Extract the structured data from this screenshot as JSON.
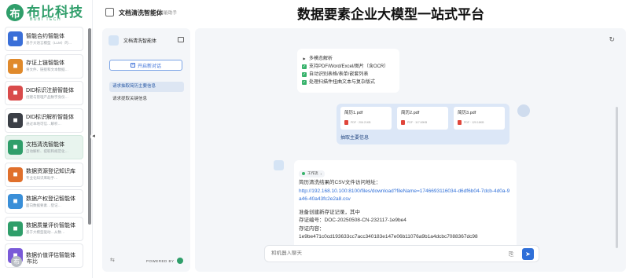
{
  "brand": {
    "logo_mark": "布",
    "name": "布比科技",
    "sub": "BUBI TECH",
    "platform_title": "数据要素企业大模型一站式平台"
  },
  "agents": [
    {
      "name": "智能合约智能体",
      "desc": "基于大语言模型（LLM）的…",
      "icon": "contract-icon",
      "color": "#3a6fd8"
    },
    {
      "name": "存证上链智能体",
      "desc": "将文件、链接和文本数据…",
      "icon": "chain-icon",
      "color": "#e08a2c"
    },
    {
      "name": "DID标识注册智能体",
      "desc": "创建与管理产品数字身份…",
      "icon": "did-icon",
      "color": "#d94b4b"
    },
    {
      "name": "DID标识解析智能体",
      "desc": "通过本地可信…解析…",
      "icon": "did-parse-icon",
      "color": "#3b3f46"
    },
    {
      "name": "文档清洗智能体",
      "desc": "自动解析、提取和规范化…",
      "icon": "doc-clean-icon",
      "color": "#2f9e6a"
    },
    {
      "name": "数据资源登记知识库",
      "desc": "专业化知识库助手…",
      "icon": "knowledge-icon",
      "color": "#e0702c"
    },
    {
      "name": "数据产权登记智能体",
      "desc": "面向数据要素…登记…",
      "icon": "property-icon",
      "color": "#3a8fd8"
    },
    {
      "name": "数据质量评价智能体",
      "desc": "基于大模型驱动…从数…",
      "icon": "quality-icon",
      "color": "#2f9e6a"
    },
    {
      "name": "数据价值评估智能体",
      "desc": "",
      "icon": "value-icon",
      "color": "#7a5ad8"
    }
  ],
  "user": {
    "avatar": "布",
    "name": "布比"
  },
  "header": {
    "title": "文档清洗智能体",
    "subtitle": "智能助手"
  },
  "session": {
    "title": "文档清洗智能体",
    "new_chat": "开启新对话",
    "history": [
      "请求抽取简历主要信息",
      "请求提取关键信息"
    ],
    "powered_by": "POWERED BY"
  },
  "chat": {
    "ai1": {
      "header": "多模态解析",
      "items": [
        "支持PDF/Word/Excel/图片（含OCR）",
        "自动识别表格/表单/嵌套列表",
        "处理扫描件扭曲文本与复杂版式"
      ]
    },
    "user_msg": {
      "files": [
        {
          "name": "简历1.pdf",
          "meta": "PDF · 206.21KB"
        },
        {
          "name": "简历2.pdf",
          "meta": "PDF · 117.69KB"
        },
        {
          "name": "简历3.pdf",
          "meta": "PDF · 120.18KB"
        }
      ],
      "text": "抽取主要信息"
    },
    "ai2": {
      "workflow_label": "工作流",
      "line1": "简历清洗结果的CSV文件访问地址：",
      "link": "http://192.168.10.100:8100/files/download?fileName=1746693116034-d6df6b04-7dcb-4d0a-9a46-40a43fc2e2a8.csv",
      "line2": "准备创建新存证记录，其中",
      "line3": "存证编号：DOC-20250508-CN-232117-1e9be4",
      "line4": "存证内容：",
      "line5": "1e9be471c0cd193633cc7acc340183e147e06b11076a9b1a4dcbc7088367dc98"
    },
    "composer": {
      "placeholder": "和机器人聊天"
    }
  }
}
